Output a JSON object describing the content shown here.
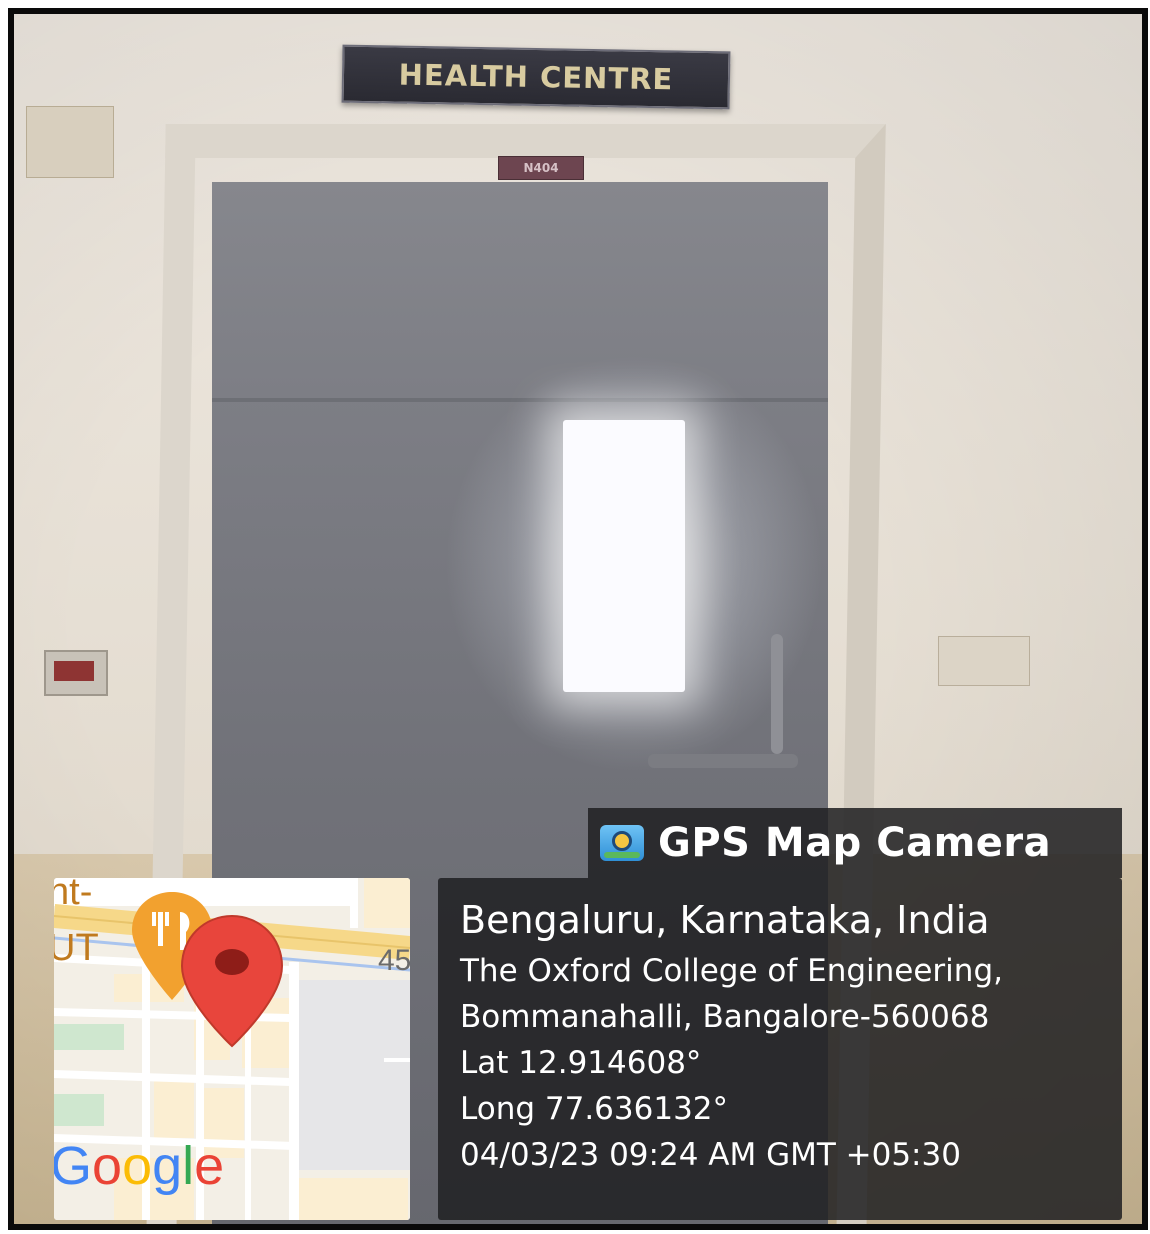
{
  "scene": {
    "sign_text": "HEALTH CENTRE",
    "room_number": "N404"
  },
  "overlay": {
    "app_name": "GPS Map Camera",
    "app_icon": "camera-pin-icon",
    "location": "Bengaluru, Karnataka, India",
    "address_line1": "The Oxford College of Engineering,",
    "address_line2": "Bommanahalli, Bangalore-560068",
    "latitude": "Lat 12.914608°",
    "longitude": "Long 77.636132°",
    "timestamp": "04/03/23 09:24 AM GMT +05:30"
  },
  "map": {
    "label_top": "nt-",
    "label_mid": "UT",
    "road_number": "45",
    "logo_text": "Google",
    "pin_color": "#e8453c",
    "poi_color": "#f2a12f",
    "poi_icon": "fork-knife-icon",
    "pin_icon": "map-pin-icon"
  }
}
